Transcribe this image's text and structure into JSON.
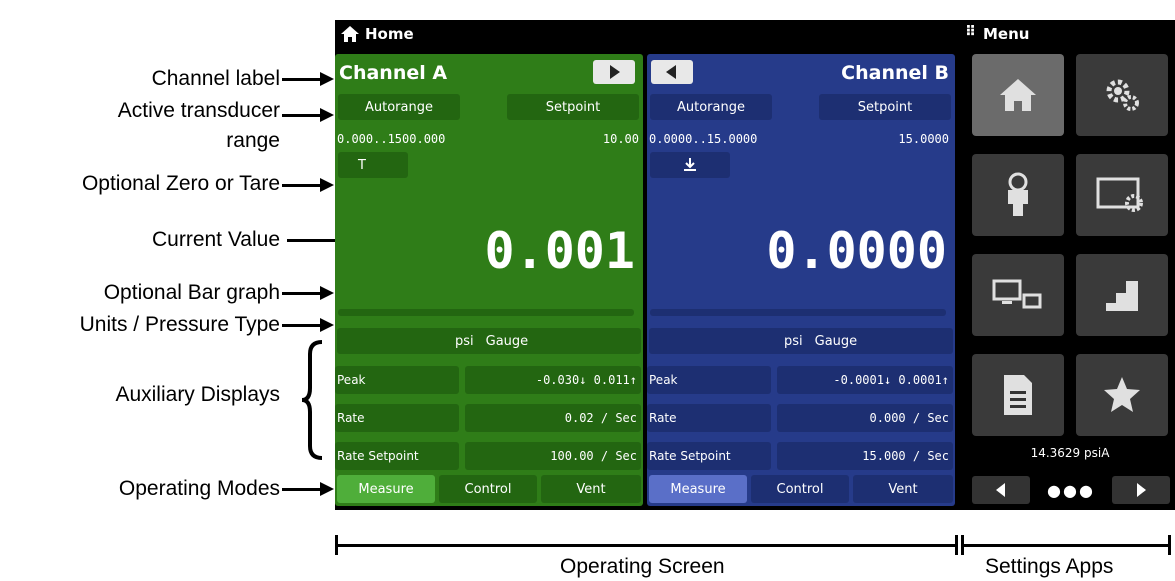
{
  "annotations": {
    "channel_label": "Channel label",
    "active_range_1": "Active transducer",
    "active_range_2": "range",
    "zero_tare": "Optional Zero or Tare",
    "current_value": "Current Value",
    "bar_graph": "Optional Bar graph",
    "units": "Units / Pressure Type",
    "aux": "Auxiliary Displays",
    "modes": "Operating Modes",
    "operating_screen": "Operating Screen",
    "settings_apps": "Settings Apps"
  },
  "screen": {
    "title": "Home",
    "menu": "Menu",
    "channel_a": {
      "name": "Channel A",
      "range_btn": "Autorange",
      "setpoint_btn": "Setpoint",
      "range": "0.000..1500.000",
      "setpoint": "10.00",
      "zero_btn": "T",
      "value": "0.001",
      "unit": "psi",
      "ptype": "Gauge",
      "peak_label": "Peak",
      "peak_value": "-0.030↓  0.011↑",
      "rate_label": "Rate",
      "rate_value": "0.02 / Sec",
      "rsp_label": "Rate Setpoint",
      "rsp_value": "100.00 / Sec",
      "modes": [
        "Measure",
        "Control",
        "Vent"
      ]
    },
    "channel_b": {
      "name": "Channel B",
      "range_btn": "Autorange",
      "setpoint_btn": "Setpoint",
      "range": "0.0000..15.0000",
      "setpoint": "15.0000",
      "value": "0.0000",
      "unit": "psi",
      "ptype": "Gauge",
      "peak_label": "Peak",
      "peak_value": "-0.0001↓  0.0001↑",
      "rate_label": "Rate",
      "rate_value": "0.000 / Sec",
      "rsp_label": "Rate Setpoint",
      "rsp_value": "15.000 / Sec",
      "modes": [
        "Measure",
        "Control",
        "Vent"
      ]
    },
    "barometer": "14.3629 psiA",
    "colors": {
      "channel_a": "#2f7d18",
      "channel_b": "#263b8a",
      "active_mode": "#4fae3a"
    }
  }
}
